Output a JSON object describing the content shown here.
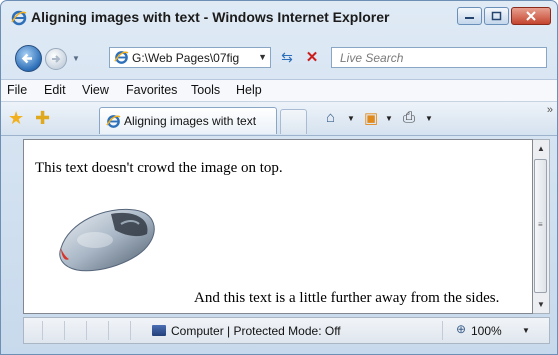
{
  "window": {
    "title": "Aligning images with text - Windows Internet Explorer"
  },
  "navigation": {
    "address": "G:\\Web Pages\\07fig",
    "search_placeholder": "Live Search"
  },
  "menu": {
    "items": [
      "File",
      "Edit",
      "View",
      "Favorites",
      "Tools",
      "Help"
    ]
  },
  "tab": {
    "title": "Aligning images with text"
  },
  "page": {
    "text_top": "This text doesn't crowd the image on top.",
    "text_bottom": "And this text is a little further away from the sides."
  },
  "status": {
    "zone": "Computer | Protected Mode: Off",
    "zoom": "100%"
  },
  "colors": {
    "accent": "#2d6fb8",
    "stop": "#cc1d1d",
    "mouse_accent": "#d8352a"
  }
}
